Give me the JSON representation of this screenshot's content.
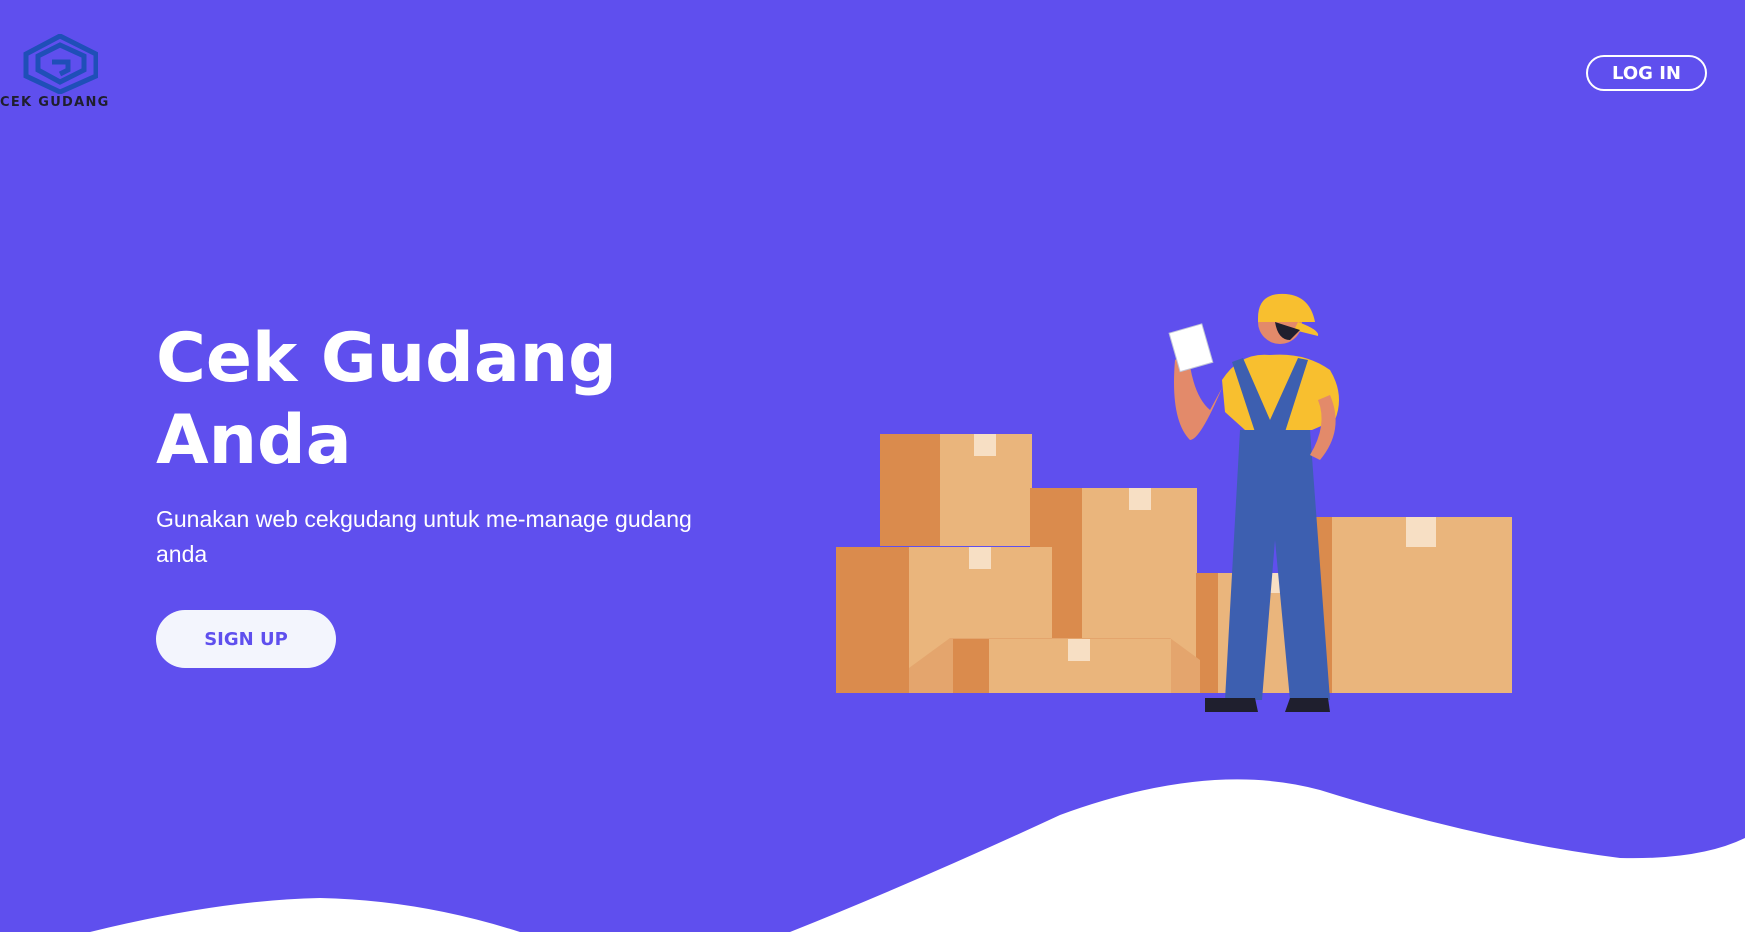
{
  "brand": {
    "name": "CEK GUDANG",
    "logo_icon": "hexagon-g-logo",
    "logo_color": "#1f4fb8"
  },
  "nav": {
    "login_label": "LOG IN"
  },
  "hero": {
    "title": "Cek Gudang Anda",
    "subtitle": "Gunakan web cekgudang untuk me-manage gudang anda",
    "signup_label": "SIGN UP"
  },
  "colors": {
    "background": "#5f4fee",
    "white": "#ffffff",
    "button_bg": "#f3f5fd"
  }
}
